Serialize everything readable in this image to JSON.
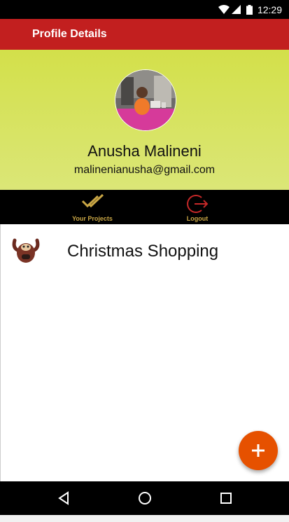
{
  "status_bar": {
    "time": "12:29",
    "icons": [
      "wifi-icon",
      "signal-icon",
      "battery-icon"
    ]
  },
  "app_bar": {
    "title": "Profile Details",
    "color": "#c21f1f"
  },
  "profile": {
    "name": "Anusha Malineni",
    "email": "malinenianusha@gmail.com",
    "header_gradient": [
      "#d3e04a",
      "#dbe677"
    ]
  },
  "actions": [
    {
      "label": "Your Projects",
      "icon": "double-check-icon",
      "color": "#c9a645"
    },
    {
      "label": "Logout",
      "icon": "logout-icon",
      "color": "#c9a645",
      "icon_color": "#c62828"
    }
  ],
  "projects": [
    {
      "title": "Christmas Shopping",
      "icon": "monster-icon"
    }
  ],
  "fab": {
    "icon": "plus-icon",
    "color": "#e65100"
  },
  "nav_bar": {
    "icons": [
      "back-icon",
      "home-icon",
      "recents-icon"
    ]
  }
}
